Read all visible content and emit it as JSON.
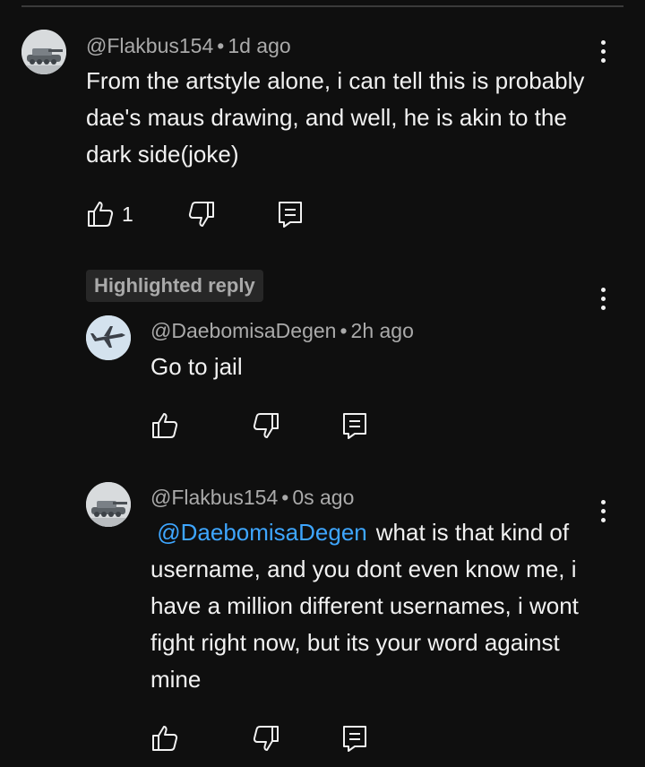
{
  "comments": [
    {
      "author": "@Flakbus154",
      "time": "1d ago",
      "text": "From the artstyle alone, i can tell this is probably dae's maus drawing, and well, he is akin to the dark side(joke)",
      "like_count": "1",
      "avatar_icon": "tank-avatar"
    },
    {
      "chip": "Highlighted reply",
      "author": "@DaebomisaDegen",
      "time": "2h ago",
      "text": "Go to jail",
      "avatar_icon": "plane-avatar"
    },
    {
      "author": "@Flakbus154",
      "time": "0s ago",
      "mention": "@DaebomisaDegen",
      "text": "what is that kind of username, and you dont even know me, i have a million different usernames, i wont fight right now, but its your word against mine",
      "avatar_icon": "tank-avatar"
    }
  ],
  "separator": "•",
  "icons": [
    "thumbs-up-icon",
    "thumbs-down-icon",
    "reply-icon",
    "more-vert-icon"
  ],
  "colors": {
    "background": "#0f0f0f",
    "mention": "#3ea6ff",
    "meta": "#aaaaaa",
    "chip_bg": "#272727"
  }
}
